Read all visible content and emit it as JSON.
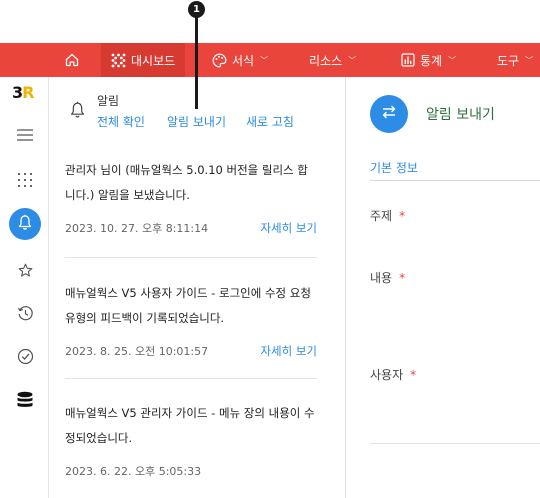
{
  "callout": {
    "number": "1"
  },
  "topnav": {
    "items": [
      {
        "label": "대시보드",
        "icon": "dashboard-dots-icon",
        "active": true
      },
      {
        "label": "서식",
        "icon": "palette-icon"
      },
      {
        "label": "리소스"
      },
      {
        "label": "통계",
        "icon": "chart-icon"
      },
      {
        "label": "도구"
      }
    ]
  },
  "rail": {
    "logo_main": "3",
    "logo_accent": "R",
    "icons": [
      "menu-icon",
      "grid-dots-icon",
      "bell-icon",
      "star-icon",
      "history-icon",
      "check-circle-icon",
      "database-icon"
    ]
  },
  "panel": {
    "title": "알림",
    "actions": {
      "view_all": "전체 확인",
      "send": "알림 보내기",
      "refresh": "새로 고침"
    },
    "notifications": [
      {
        "message": "관리자 님이 (매뉴얼웍스 5.0.10 버전을 릴리스 합니다.) 알림을 보냈습니다.",
        "date": "2023. 10. 27. 오후 8:11:14",
        "link": "자세히 보기"
      },
      {
        "message": "매뉴얼웍스 V5 사용자 가이드 - 로그인에 수정 요청 유형의 피드백이 기록되었습니다.",
        "date": "2023. 8. 25. 오전 10:01:57",
        "link": "자세히 보기"
      },
      {
        "message": "매뉴얼웍스 V5 관리자 가이드 - 메뉴 장의 내용이 수정되었습니다.",
        "date": "2023. 6. 22. 오후 5:05:33",
        "link": ""
      }
    ]
  },
  "form": {
    "title": "알림 보내기",
    "section": "기본 정보",
    "fields": [
      {
        "label": "주제",
        "required": "*"
      },
      {
        "label": "내용",
        "required": "*"
      },
      {
        "label": "사용자",
        "required": "*"
      }
    ]
  },
  "colors": {
    "accent_red": "#e9453c",
    "accent_blue": "#2c8ce6",
    "logo_yellow": "#f0b400"
  }
}
